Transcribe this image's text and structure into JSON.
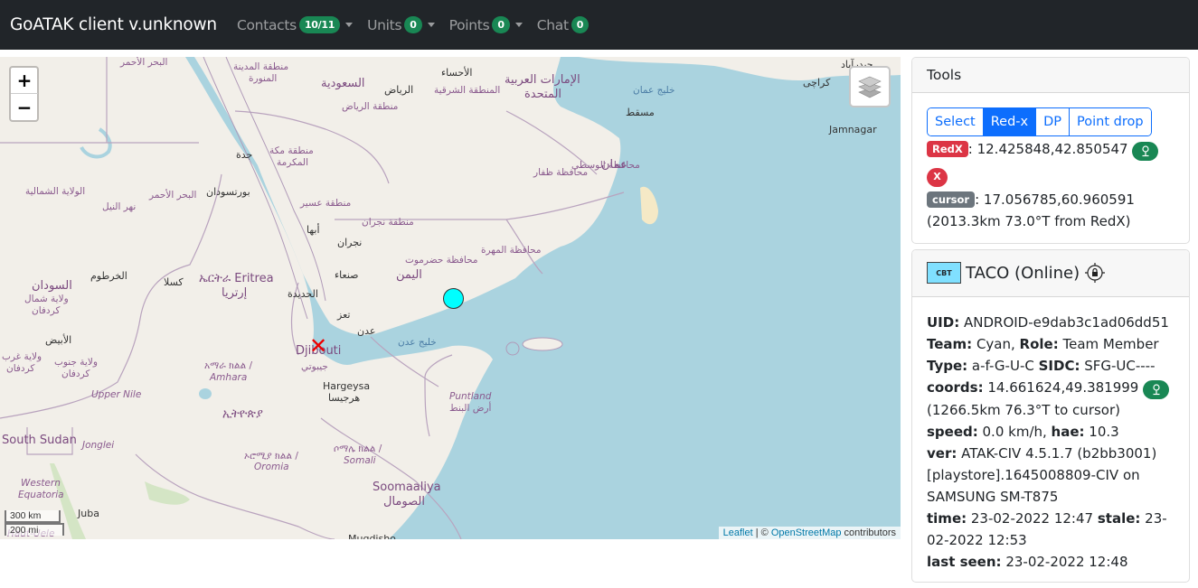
{
  "navbar": {
    "brand": "GoATAK client v.unknown",
    "items": [
      {
        "label": "Contacts",
        "badge": "10/11",
        "dropdown": true
      },
      {
        "label": "Units",
        "badge": "0",
        "dropdown": true
      },
      {
        "label": "Points",
        "badge": "0",
        "dropdown": true
      },
      {
        "label": "Chat",
        "badge": "0",
        "dropdown": false
      }
    ]
  },
  "map": {
    "zoom_in": "+",
    "zoom_out": "−",
    "layers_icon": "layers-icon",
    "scale": {
      "km": "300 km",
      "mi": "200 mi"
    },
    "attribution": {
      "leaflet": "Leaflet",
      "sep": " | © ",
      "osm": "OpenStreetMap",
      "suffix": " contributors"
    },
    "markers": {
      "redx": {
        "label": "RedX",
        "coords": "12.425848,42.850547"
      },
      "unit": {
        "name": "TACO",
        "color": "#00ffff"
      }
    },
    "labels": {
      "egypt_redsea": "البحر الأحمر",
      "madinah": "منطقة المدينة",
      "madinah2": "المنورة",
      "saudi": "السعودية",
      "riyadh": "الرياض",
      "riyadh_region": "منطقة الرياض",
      "ahsa": "الأحساء",
      "eastern": "المنطقة الشرقية",
      "uae1": "الإمارات العربية",
      "uae2": "المتحدة",
      "oman_gulf": "خليج عمان",
      "muscat": "مسقط",
      "karachi": "كراچی",
      "hyderabad": "حیدرآباد",
      "jamnagar": "Jamnagar",
      "oman": "عمان",
      "wusta": "محافظة الوسطى",
      "dhofar": "محافظة ظفار",
      "jeddah": "جدة",
      "makkah1": "منطقة مكة",
      "makkah2": "المكرمة",
      "northern_state": "الولاية الشمالية",
      "redsea_state": "البحر الأحمر",
      "portsudan": "بورتسودان",
      "nile": "نهر النيل",
      "asir": "منطقة عسير",
      "abha": "أبها",
      "najran_region": "منطقة نجران",
      "najran": "نجران",
      "mahra": "محافظة المهرة",
      "hadramaut": "محافظة حضرموت",
      "yemen": "اليمن",
      "sanaa": "صنعاء",
      "hodeidah": "الحديدة",
      "taiz": "تعز",
      "aden": "عدن",
      "gulf_aden": "خليج عدن",
      "khartoum": "الخرطوم",
      "sudan": "السودان",
      "kassala": "كسلا",
      "eritrea": "ኤርትራ Eritrea",
      "eritrea_ar": "إرتريا",
      "n_kordofan1": "ولاية شمال",
      "n_kordofan2": "كردفان",
      "obeid": "الأبيض",
      "w_kordofan1": "ولاية غرب",
      "w_kordofan2": "كردفان",
      "s_kordofan1": "ولاية جنوب",
      "s_kordofan2": "كردفان",
      "amhara1": "አማራ ክልል /",
      "amhara2": "Amhara",
      "upper_nile": "Upper Nile",
      "ethiopia": "ኢትዮጵያ",
      "djibouti": "Djibouti",
      "djibouti_ar": "جيبوتي",
      "hargeysa": "Hargeysa",
      "hargeysa_ar": "هرجيسا",
      "puntland": "Puntland",
      "puntland_ar": "أرض البنط",
      "south_sudan": "South Sudan",
      "jonglei": "Jonglei",
      "oromia1": "ኦሮሚያ ክልል /",
      "oromia2": "Oromia",
      "somali1": "ሶማሌ ክልል /",
      "somali2": "Somali",
      "w_equatoria1": "Western",
      "w_equatoria2": "Equatoria",
      "somalia": "Soomaaliya",
      "somalia_ar": "الصومال",
      "juba": "Juba",
      "haut_uele": "Haut-Uele",
      "mogadishu": "Muqdisho"
    }
  },
  "tools": {
    "title": "Tools",
    "modes": [
      {
        "label": "Select",
        "active": false
      },
      {
        "label": "Red-x",
        "active": true
      },
      {
        "label": "DP",
        "active": false
      },
      {
        "label": "Point drop",
        "active": false
      }
    ],
    "redx": {
      "badge": "RedX",
      "coords": ": 12.425848,42.850547",
      "delete": "X"
    },
    "cursor": {
      "badge": "cursor",
      "coords": ": 17.056785,60.960591",
      "distance": "(2013.3km 73.0°T from RedX)"
    }
  },
  "unit": {
    "icon_label": "CBT",
    "title": "TACO (Online)",
    "fields": {
      "uid_label": "UID:",
      "uid": " ANDROID-e9dab3c1ad06dd51",
      "team_label": "Team:",
      "team": " Cyan, ",
      "role_label": "Role:",
      "role": " Team Member",
      "type_label": "Type:",
      "type": " a-f-G-U-C ",
      "sidc_label": "SIDC:",
      "sidc": " SFG-UC----",
      "coords_label": "coords:",
      "coords": " 14.661624,49.381999 ",
      "coords_distance": "(1266.5km 76.3°T to cursor)",
      "speed_label": "speed:",
      "speed": " 0.0 km/h, ",
      "hae_label": "hae:",
      "hae": " 10.3",
      "ver_label": "ver:",
      "ver": " ATAK-CIV 4.5.1.7 (b2bb3001) [playstore].1645008809-CIV on SAMSUNG SM-T875",
      "time_label": "time:",
      "time": " 23-02-2022 12:47 ",
      "stale_label": "stale:",
      "stale": " 23-02-2022 12:53",
      "last_seen_label": "last seen:",
      "last_seen": " 23-02-2022 12:48"
    }
  }
}
